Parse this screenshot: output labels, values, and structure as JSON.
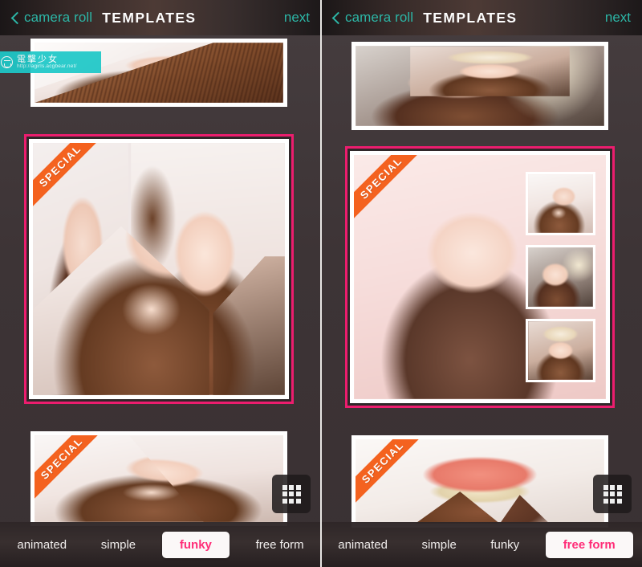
{
  "panels": [
    {
      "id": "left",
      "header": {
        "back_icon": "chevron-left-icon",
        "back_label": "camera roll",
        "title": "TEMPLATES",
        "next_label": "next"
      },
      "watermark": {
        "icon": "smiley-face-icon",
        "title": "電擊少女",
        "url": "http://agirls.acgbear.net/"
      },
      "templates": [
        {
          "id": "top-partial",
          "badge": null,
          "selected": false,
          "layout": "diagonal-2"
        },
        {
          "id": "funky-four-up",
          "badge": "SPECIAL",
          "selected": true,
          "layout": "funky-4"
        },
        {
          "id": "bottom-partial",
          "badge": "SPECIAL",
          "selected": false,
          "layout": "diagonal-2-wide"
        }
      ],
      "grid_button": {
        "icon": "grid-3x3-icon",
        "label": "grid view"
      },
      "tabs": [
        {
          "label": "animated",
          "active": false
        },
        {
          "label": "simple",
          "active": false
        },
        {
          "label": "funky",
          "active": true
        },
        {
          "label": "free form",
          "active": false
        }
      ]
    },
    {
      "id": "right",
      "header": {
        "back_icon": "chevron-left-icon",
        "back_label": "camera roll",
        "title": "TEMPLATES",
        "next_label": "next"
      },
      "watermark": null,
      "templates": [
        {
          "id": "top-partial",
          "badge": null,
          "selected": false,
          "layout": "band-overlay"
        },
        {
          "id": "freeform-main",
          "badge": "SPECIAL",
          "selected": true,
          "layout": "hero-plus-3"
        },
        {
          "id": "bottom-partial",
          "badge": "SPECIAL",
          "selected": false,
          "layout": "diagonal-pair"
        }
      ],
      "grid_button": {
        "icon": "grid-3x3-icon",
        "label": "grid view"
      },
      "tabs": [
        {
          "label": "animated",
          "active": false
        },
        {
          "label": "simple",
          "active": false
        },
        {
          "label": "funky",
          "active": false
        },
        {
          "label": "free form",
          "active": true
        }
      ]
    }
  ],
  "colors": {
    "accent_teal": "#2cb6a6",
    "accent_pink": "#ff2d78",
    "selected_border": "#ec1d6e",
    "ribbon_orange": "#f4621f",
    "background": "#3d3436",
    "watermark_teal": "#1ec8c8"
  }
}
